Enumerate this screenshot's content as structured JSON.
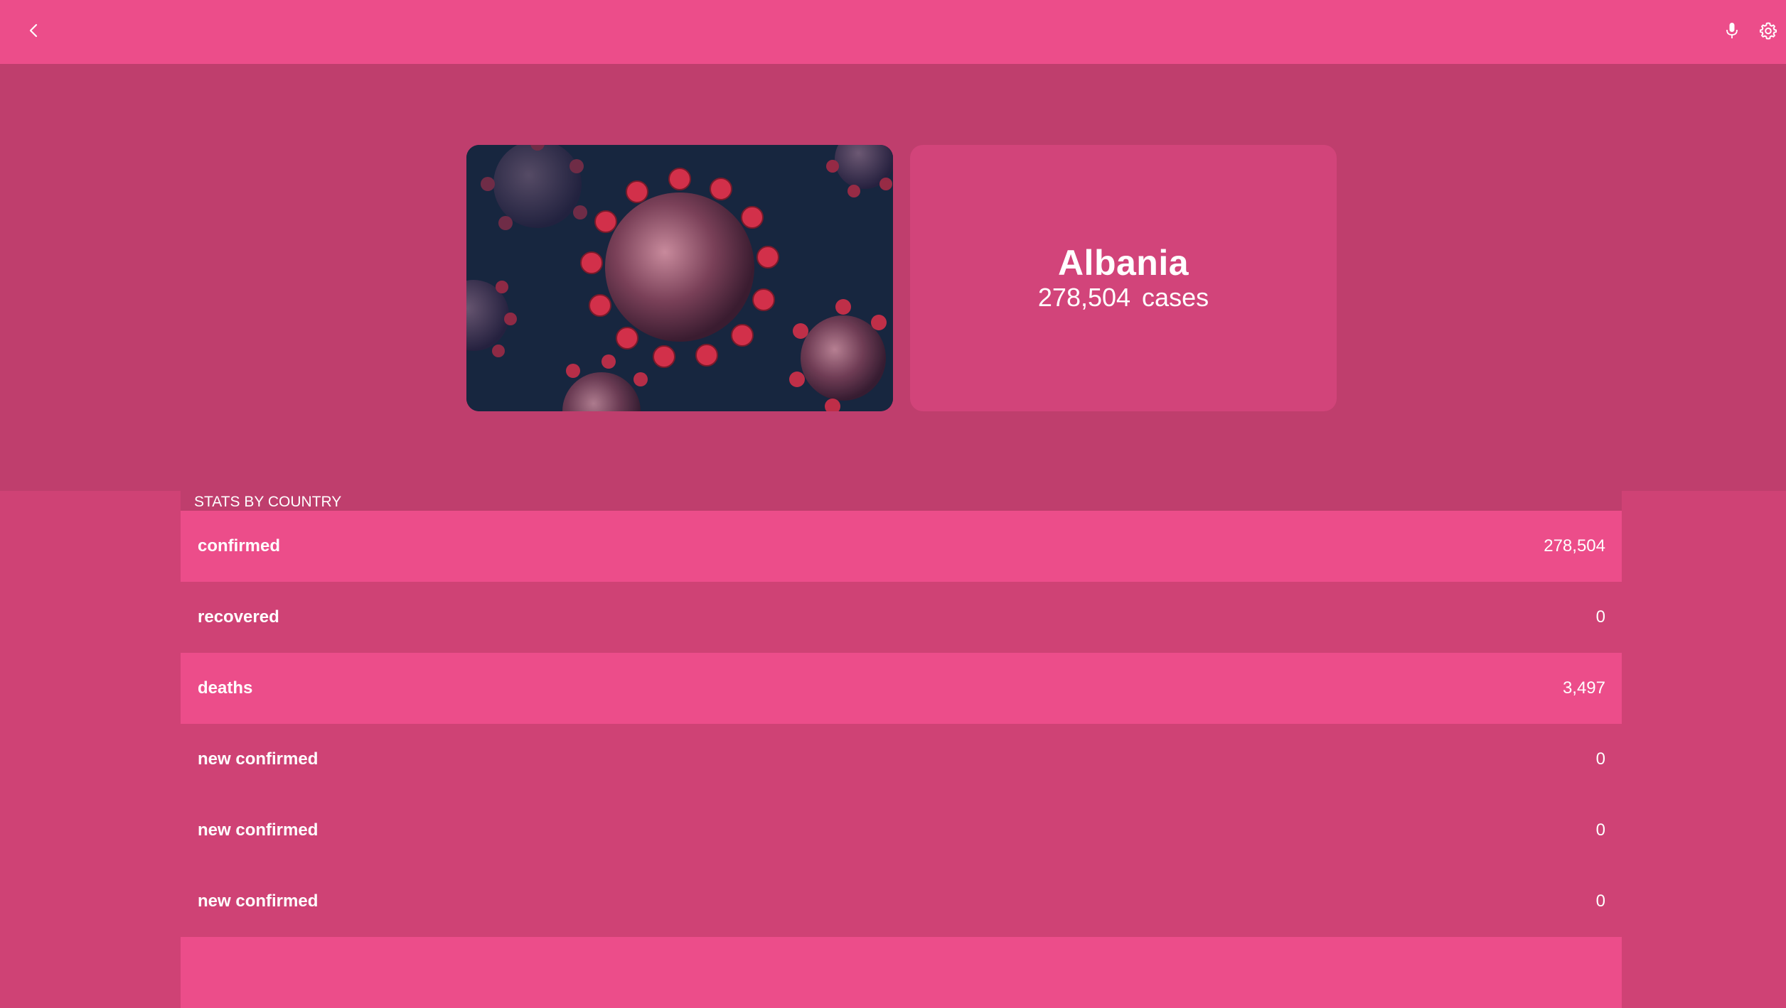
{
  "topbar": {
    "back_icon": "chevron-left-icon",
    "mic_icon": "microphone-icon",
    "settings_icon": "gear-icon"
  },
  "hero": {
    "image_alt": "coronavirus particles",
    "country": "Albania",
    "case_count": "278,504",
    "case_unit": "cases"
  },
  "stats": {
    "header": "STATS BY COUNTRY",
    "rows": [
      {
        "label": "confirmed",
        "value": "278,504"
      },
      {
        "label": "recovered",
        "value": "0"
      },
      {
        "label": "deaths",
        "value": "3,497"
      },
      {
        "label": "new confirmed",
        "value": "0"
      },
      {
        "label": "new confirmed",
        "value": "0"
      },
      {
        "label": "new confirmed",
        "value": "0"
      }
    ]
  },
  "colors": {
    "topbar": "#ec4d8a",
    "hero_bg": "#bf3e6d",
    "card": "#d2447a",
    "row_highlight": "#ec4d8a",
    "row_plain": "#cf4275"
  }
}
